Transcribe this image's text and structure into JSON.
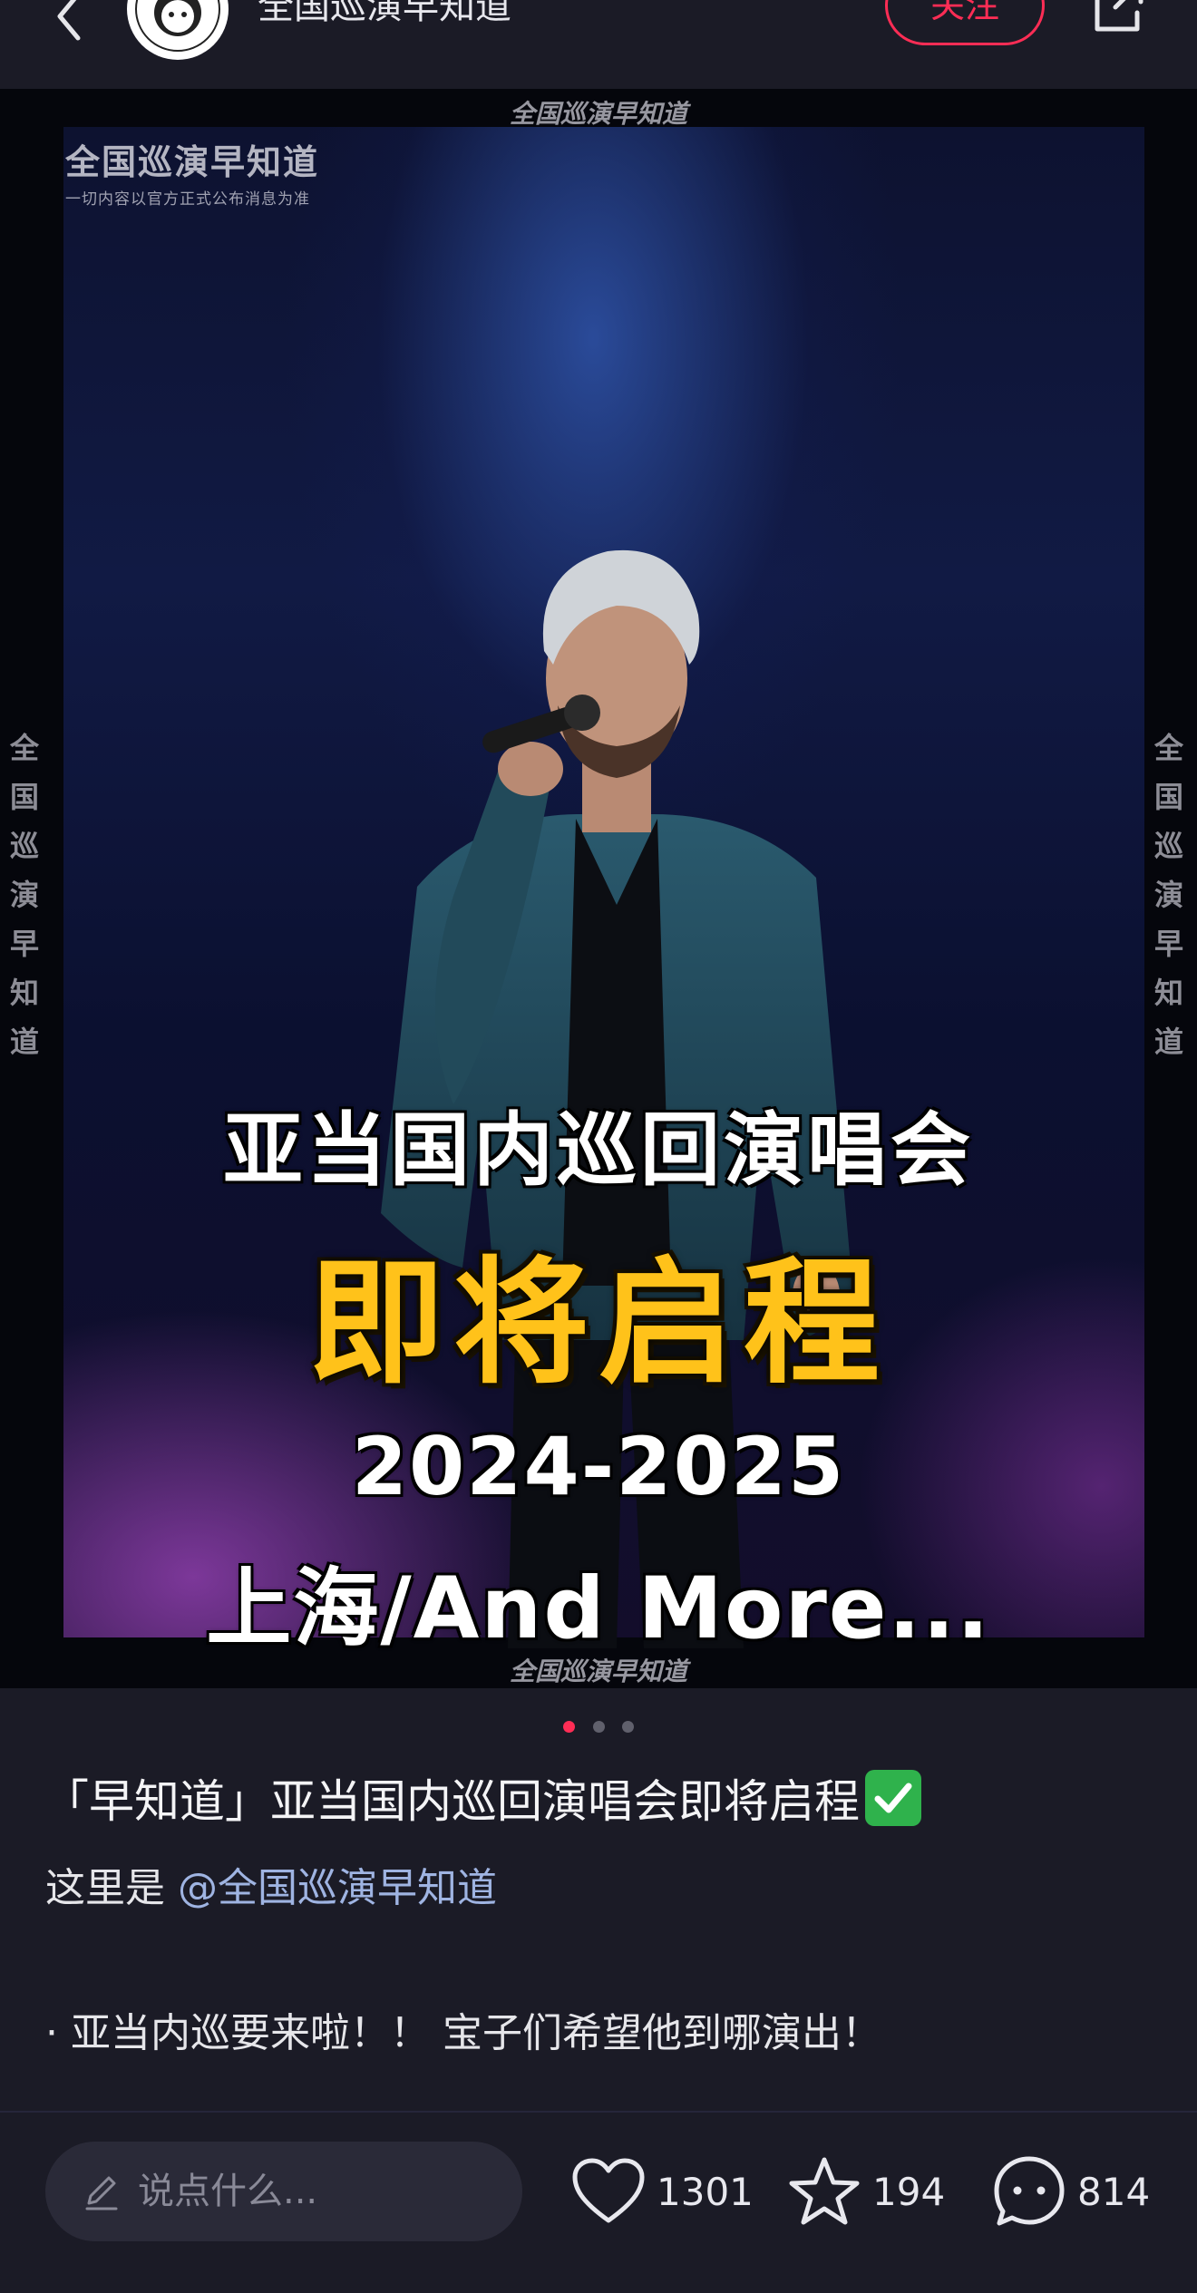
{
  "header": {
    "author_name": "全国巡演早知道",
    "follow_label": "关注"
  },
  "poster": {
    "watermark_top": "全国巡演早知道",
    "watermark_bottom": "全国巡演早知道",
    "logo_title": "全国巡演早知道",
    "logo_subtitle": "一切内容以官方正式公布消息为准",
    "side_watermark": [
      "全",
      "国",
      "巡",
      "演",
      "早",
      "知",
      "道"
    ],
    "headline_1": "亚当国内巡回演唱会",
    "headline_2": "即将启程",
    "headline_3": "2024-2025",
    "headline_4": "上海/And More..."
  },
  "carousel": {
    "total": 3,
    "active": 1
  },
  "post": {
    "title": "「早知道」亚当国内巡回演唱会即将启程",
    "intro_prefix": "这里是 ",
    "mention": "@全国巡演早知道",
    "bullet": "·  亚当内巡要来啦！！ 宝子们希望他到哪演出！"
  },
  "bottom_bar": {
    "comment_placeholder": "说点什么...",
    "likes": "1301",
    "favorites": "194",
    "comments": "814"
  },
  "colors": {
    "accent": "#ff2d55",
    "highlight_yellow": "#ffc21a",
    "background": "#1b1b26"
  }
}
